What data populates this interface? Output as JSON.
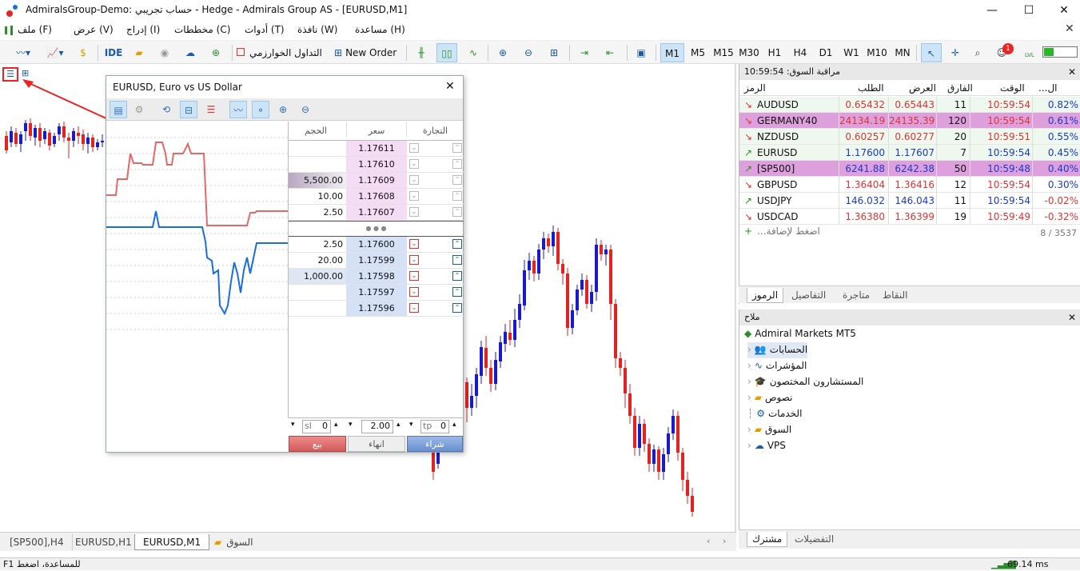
{
  "window": {
    "title": "AdmiralsGroup-Demo: حساب تجريبي - Hedge - Admirals Group AS - [EURUSD,M1]",
    "minimize": "—",
    "maximize": "☐",
    "close": "✕"
  },
  "menu": [
    "ملف (F)",
    "عرض (V)",
    "إدراج (I)",
    "مخططات (C)",
    "أدوات (T)",
    "نافذة (W)",
    "مساعدة (H)"
  ],
  "toolbar": {
    "ide": "IDE",
    "algo": "التداول الخوارزمي",
    "new_order": "New Order",
    "timeframes": [
      "M1",
      "M5",
      "M15",
      "M30",
      "H1",
      "H4",
      "D1",
      "W1",
      "M10",
      "MN"
    ],
    "active_timeframe": "M1",
    "notification_count": "1",
    "lvl": "LVL"
  },
  "dom": {
    "title": "EURUSD, Euro vs US Dollar",
    "col_trade": "التجارة",
    "col_price": "سعر",
    "col_volume": "الحجم",
    "asks": [
      {
        "price": "1.17611",
        "volume": ""
      },
      {
        "price": "1.17610",
        "volume": ""
      },
      {
        "price": "1.17609",
        "volume": "5,500.00"
      },
      {
        "price": "1.17608",
        "volume": "10.00"
      },
      {
        "price": "1.17607",
        "volume": "2.50"
      }
    ],
    "separator": "● ● ●",
    "bids": [
      {
        "price": "1.17600",
        "volume": "2.50"
      },
      {
        "price": "1.17599",
        "volume": "20.00"
      },
      {
        "price": "1.17598",
        "volume": "1,000.00"
      },
      {
        "price": "1.17597",
        "volume": ""
      },
      {
        "price": "1.17596",
        "volume": ""
      }
    ],
    "sl_label": "sl",
    "sl_value": "0",
    "lot_value": "2.00",
    "tp_label": "tp",
    "tp_value": "0",
    "sell_label": "بيع",
    "close_label": "انهاء",
    "buy_label": "شراء"
  },
  "watch": {
    "header": "مراقبة السوق: 10:59:54",
    "cols": {
      "symbol": "الرمز",
      "bid": "الطلب",
      "ask": "العرض",
      "spread": "الفارق",
      "time": "الوقت",
      "change": "...ال"
    },
    "rows": [
      {
        "symbol": "AUDUSD",
        "bid": "0.65432",
        "ask": "0.65443",
        "spread": "11",
        "time": "10:59:54",
        "change": "0.82%",
        "dir": "down"
      },
      {
        "symbol": "GERMANY40",
        "bid": "24134.19",
        "ask": "24135.39",
        "spread": "120",
        "time": "10:59:54",
        "change": "0.61%",
        "dir": "down"
      },
      {
        "symbol": "NZDUSD",
        "bid": "0.60257",
        "ask": "0.60277",
        "spread": "20",
        "time": "10:59:51",
        "change": "0.55%",
        "dir": "down"
      },
      {
        "symbol": "EURUSD",
        "bid": "1.17600",
        "ask": "1.17607",
        "spread": "7",
        "time": "10:59:54",
        "change": "0.45%",
        "dir": "up"
      },
      {
        "symbol": "[SP500]",
        "bid": "6241.88",
        "ask": "6242.38",
        "spread": "50",
        "time": "10:59:48",
        "change": "0.40%",
        "dir": "up"
      },
      {
        "symbol": "GBPUSD",
        "bid": "1.36404",
        "ask": "1.36416",
        "spread": "12",
        "time": "10:59:54",
        "change": "0.30%",
        "dir": "down"
      },
      {
        "symbol": "USDJPY",
        "bid": "146.032",
        "ask": "146.043",
        "spread": "11",
        "time": "10:59:54",
        "change": "-0.02%",
        "dir": "up"
      },
      {
        "symbol": "USDCAD",
        "bid": "1.36380",
        "ask": "1.36399",
        "spread": "19",
        "time": "10:59:49",
        "change": "-0.32%",
        "dir": "down"
      }
    ],
    "add": "...اضغط لإضافة",
    "count": "8 / 3537",
    "tabs": [
      "الرموز",
      "التفاصيل",
      "متاجرة",
      "النقاط"
    ]
  },
  "navigator": {
    "header": "ملاح",
    "root": "Admiral Markets MT5",
    "items": [
      "الحسابات",
      "المؤشرات",
      "المستشارون المختصون",
      "نصوص",
      "الخدمات",
      "السوق",
      "VPS"
    ],
    "tabs": [
      "مشترك",
      "التفضيلات"
    ]
  },
  "chart_tabs": [
    "[SP500],H4",
    "EURUSD,H1",
    "EURUSD,M1",
    "السوق"
  ],
  "status": {
    "help": "F1 للمساعدة، اضغط",
    "ping": "69.14 ms"
  }
}
